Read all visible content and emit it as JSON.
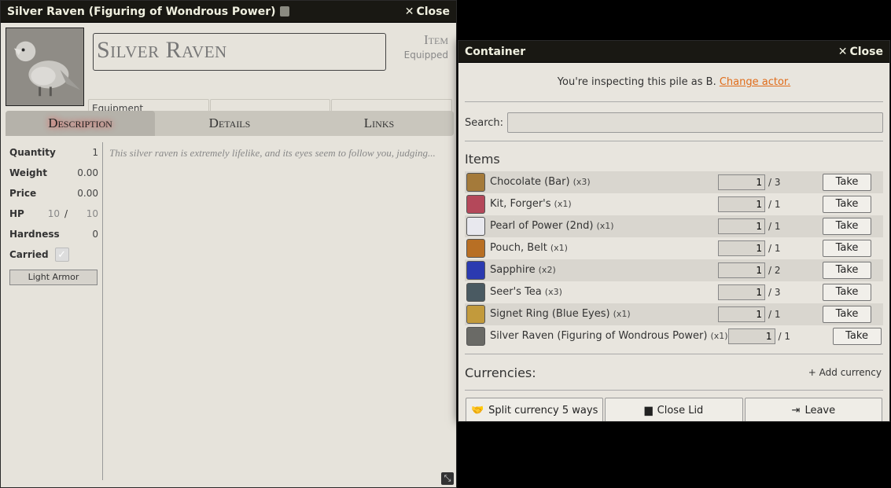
{
  "item_sheet": {
    "window_title": "Silver Raven (Figuring of Wondrous Power)",
    "close_label": "Close",
    "name": "Silver Raven",
    "type_label": "Item",
    "status_label": "Equipped",
    "tags": [
      "Equipment",
      "",
      ""
    ],
    "tabs": [
      {
        "label": "Description",
        "active": true
      },
      {
        "label": "Details",
        "active": false
      },
      {
        "label": "Links",
        "active": false
      }
    ],
    "props": {
      "quantity_label": "Quantity",
      "quantity": "1",
      "weight_label": "Weight",
      "weight": "0.00",
      "price_label": "Price",
      "price": "0.00",
      "hp_label": "HP",
      "hp_current": "10",
      "hp_sep": "/",
      "hp_max": "10",
      "hardness_label": "Hardness",
      "hardness": "0",
      "carried_label": "Carried"
    },
    "armor_button": "Light Armor",
    "description": "This silver raven is extremely lifelike, and its eyes seem to follow you, judging..."
  },
  "container": {
    "window_title": "Container",
    "close_label": "Close",
    "inspect_text": "You're inspecting this pile as B.",
    "change_actor": "Change actor.",
    "search_label": "Search:",
    "search_value": "",
    "items_title": "Items",
    "items": [
      {
        "name": "Chocolate (Bar)",
        "count": "(x3)",
        "qty": "1",
        "max": "/ 3",
        "take": "Take",
        "icon_color": "#a47a3a"
      },
      {
        "name": "Kit, Forger's",
        "count": "(x1)",
        "qty": "1",
        "max": "/ 1",
        "take": "Take",
        "icon_color": "#b4485a"
      },
      {
        "name": "Pearl of Power (2nd)",
        "count": "(x1)",
        "qty": "1",
        "max": "/ 1",
        "take": "Take",
        "icon_color": "#e8e8ee"
      },
      {
        "name": "Pouch, Belt",
        "count": "(x1)",
        "qty": "1",
        "max": "/ 1",
        "take": "Take",
        "icon_color": "#b86f24"
      },
      {
        "name": "Sapphire",
        "count": "(x2)",
        "qty": "1",
        "max": "/ 2",
        "take": "Take",
        "icon_color": "#2b3ab0"
      },
      {
        "name": "Seer's Tea",
        "count": "(x3)",
        "qty": "1",
        "max": "/ 3",
        "take": "Take",
        "icon_color": "#4a5a62"
      },
      {
        "name": "Signet Ring (Blue Eyes)",
        "count": "(x1)",
        "qty": "1",
        "max": "/ 1",
        "take": "Take",
        "icon_color": "#c29a3c"
      },
      {
        "name": "Silver Raven (Figuring of Wondrous Power)",
        "count": "(x1)",
        "qty": "1",
        "max": "/ 1",
        "take": "Take",
        "icon_color": "#6a6a66"
      }
    ],
    "currencies_label": "Currencies:",
    "add_currency": "Add currency",
    "buttons": {
      "split": "Split currency 5 ways",
      "close_lid": "Close Lid",
      "leave": "Leave"
    }
  },
  "accent_color": "#e06c1a"
}
